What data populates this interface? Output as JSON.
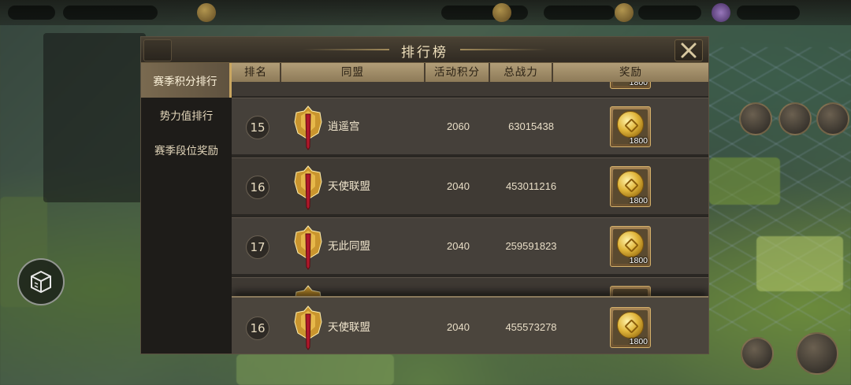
{
  "panel": {
    "title": "排行榜"
  },
  "sidebar": {
    "items": [
      {
        "label": "赛季积分排行",
        "active": true
      },
      {
        "label": "势力值排行",
        "active": false
      },
      {
        "label": "赛季段位奖励",
        "active": false
      }
    ]
  },
  "table": {
    "headers": [
      "排名",
      "同盟",
      "活动积分",
      "总战力",
      "奖励"
    ],
    "partial_top_reward": "1800",
    "rows": [
      {
        "rank": "15",
        "guild": "逍遥宫",
        "score": "2060",
        "power": "63015438",
        "reward": "1800"
      },
      {
        "rank": "16",
        "guild": "天使联盟",
        "score": "2040",
        "power": "453011216",
        "reward": "1800"
      },
      {
        "rank": "17",
        "guild": "无此同盟",
        "score": "2040",
        "power": "259591823",
        "reward": "1800"
      }
    ],
    "my_row": {
      "rank": "16",
      "guild": "天使联盟",
      "score": "2040",
      "power": "455573278",
      "reward": "1800"
    }
  },
  "colors": {
    "accent_gold": "#c9a660",
    "header_tan": "#b29e78",
    "row_brown": "#45403a"
  },
  "icons": [
    "close-icon",
    "alliance-badge-icon",
    "gold-coin-icon",
    "cube-menu-icon"
  ]
}
